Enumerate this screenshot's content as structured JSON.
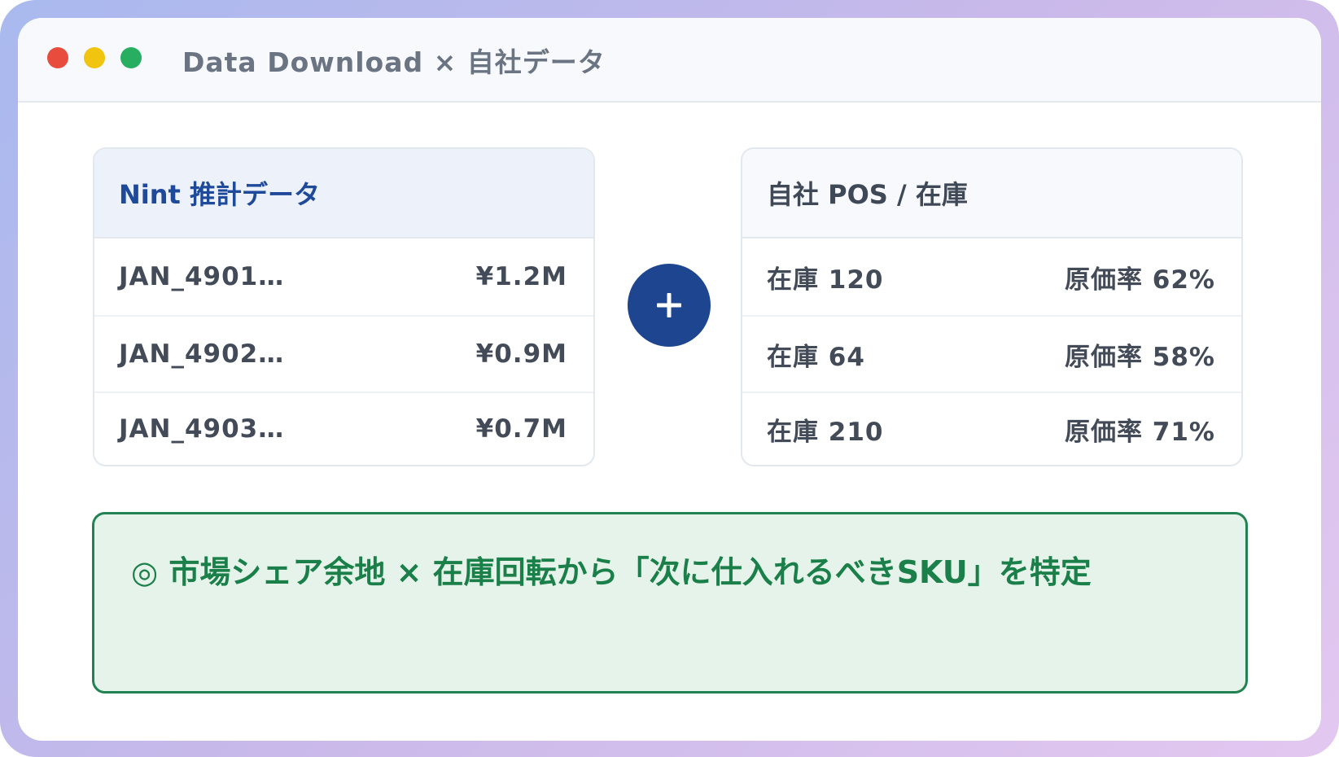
{
  "window": {
    "title": "Data Download × 自社データ"
  },
  "nint_card": {
    "title": "Nint 推計データ",
    "rows": [
      {
        "sku": "JAN_4901…",
        "value": "¥1.2M"
      },
      {
        "sku": "JAN_4902…",
        "value": "¥0.9M"
      },
      {
        "sku": "JAN_4903…",
        "value": "¥0.7M"
      }
    ]
  },
  "pos_card": {
    "title": "自社 POS / 在庫",
    "rows": [
      {
        "stock": "在庫 120",
        "cost_rate": "原価率 62%"
      },
      {
        "stock": "在庫 64",
        "cost_rate": "原価率 58%"
      },
      {
        "stock": "在庫 210",
        "cost_rate": "原価率 71%"
      }
    ]
  },
  "banner": {
    "text": "◎ 市場シェア余地 × 在庫回転から「次に仕入れるべきSKU」を特定"
  },
  "colors": {
    "accent_blue": "#1e4690",
    "success_green": "#1a7f49",
    "traffic_red": "#e74c3c",
    "traffic_yellow": "#f1c40f",
    "traffic_green": "#27ae60"
  },
  "icons": {
    "combine": "plus-icon"
  }
}
